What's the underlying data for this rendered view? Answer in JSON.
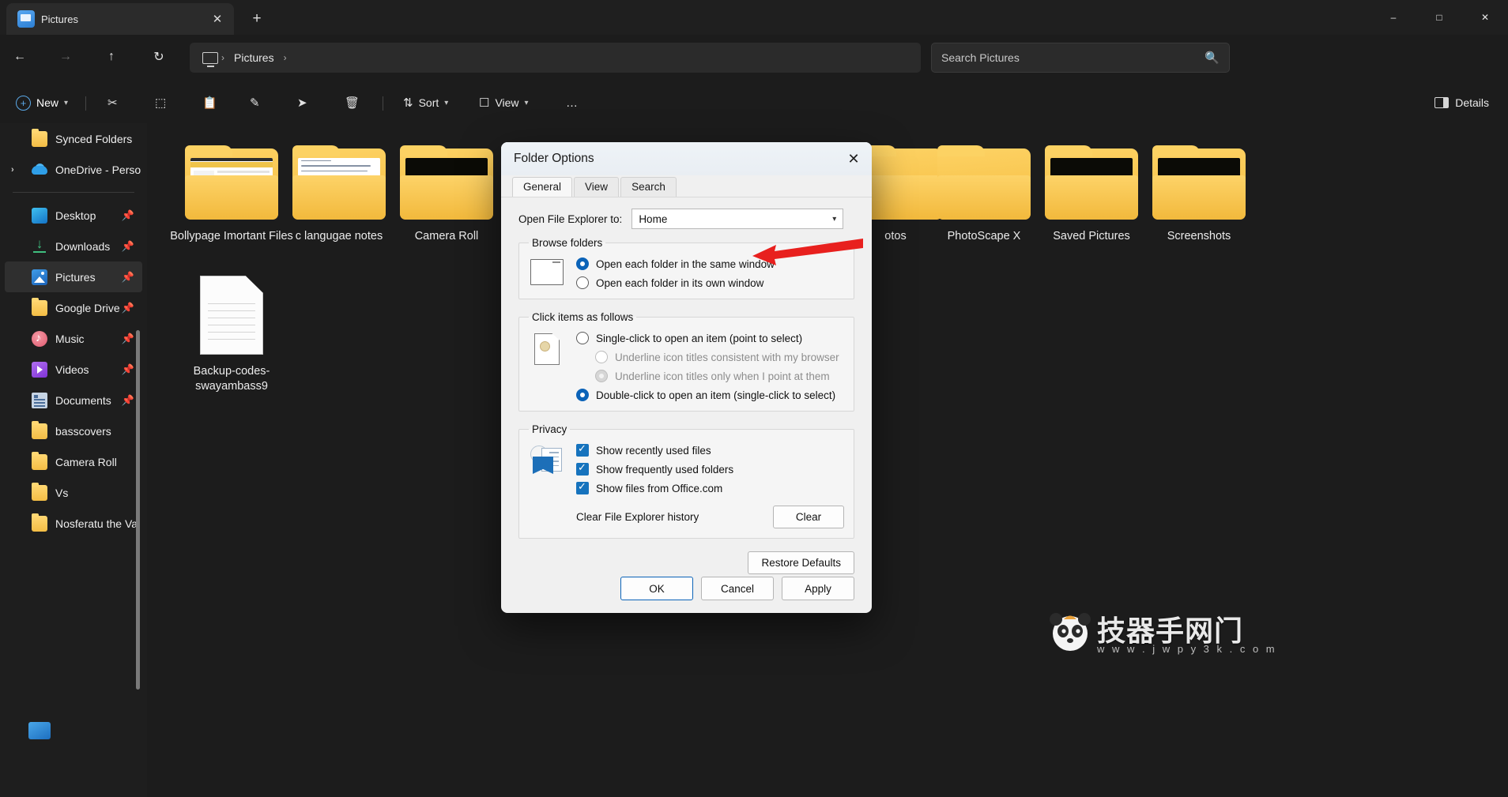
{
  "window": {
    "tab_title": "Pictures",
    "tab_close_icon": "close-icon",
    "new_tab_icon": "plus-icon",
    "minimize_icon": "minimize-icon",
    "maximize_icon": "maximize-icon",
    "close_icon": "close-icon"
  },
  "nav": {
    "back_icon": "arrow-left-icon",
    "forward_icon": "arrow-right-icon",
    "up_icon": "arrow-up-icon",
    "refresh_icon": "refresh-icon",
    "breadcrumb": [
      "Pictures"
    ],
    "separator": "›",
    "pc_icon": "this-pc-icon"
  },
  "search": {
    "placeholder": "Search Pictures",
    "icon": "search-icon"
  },
  "toolbar": {
    "new_label": "New",
    "new_icon": "plus-circle-icon",
    "chevron": "˅",
    "cut_icon": "scissors-icon",
    "copy_icon": "copy-icon",
    "paste_icon": "clipboard-icon",
    "rename_icon": "rename-icon",
    "share_icon": "share-icon",
    "delete_icon": "trash-icon",
    "sort_label": "Sort",
    "sort_icon": "sort-icon",
    "view_label": "View",
    "view_icon": "view-grid-icon",
    "more_label": "…",
    "details_label": "Details",
    "details_icon": "details-pane-icon"
  },
  "sidebar": {
    "items": [
      {
        "label": "Synced Folders",
        "icon": "folder-icon",
        "pinned": false,
        "expandable": false,
        "selected": false
      },
      {
        "label": "OneDrive - Perso",
        "icon": "cloud-icon",
        "pinned": false,
        "expandable": true,
        "selected": false
      },
      {
        "label": "Desktop",
        "icon": "desktop-icon",
        "pinned": true,
        "expandable": false,
        "selected": false
      },
      {
        "label": "Downloads",
        "icon": "download-icon",
        "pinned": true,
        "expandable": false,
        "selected": false
      },
      {
        "label": "Pictures",
        "icon": "pictures-icon",
        "pinned": true,
        "expandable": false,
        "selected": true
      },
      {
        "label": "Google Drive",
        "icon": "folder-icon",
        "pinned": true,
        "expandable": false,
        "selected": false
      },
      {
        "label": "Music",
        "icon": "music-icon",
        "pinned": true,
        "expandable": false,
        "selected": false
      },
      {
        "label": "Videos",
        "icon": "videos-icon",
        "pinned": true,
        "expandable": false,
        "selected": false
      },
      {
        "label": "Documents",
        "icon": "documents-icon",
        "pinned": true,
        "expandable": false,
        "selected": false
      },
      {
        "label": "basscovers",
        "icon": "folder-icon",
        "pinned": false,
        "expandable": false,
        "selected": false
      },
      {
        "label": "Camera Roll",
        "icon": "folder-icon",
        "pinned": false,
        "expandable": false,
        "selected": false
      },
      {
        "label": "Vs",
        "icon": "folder-icon",
        "pinned": false,
        "expandable": false,
        "selected": false
      },
      {
        "label": "Nosferatu the Va",
        "icon": "folder-icon",
        "pinned": false,
        "expandable": false,
        "selected": false
      }
    ],
    "pin_icon": "pin-icon",
    "expander_icon": "chevron-right-icon"
  },
  "files": [
    {
      "name": "Bollypage Imortant Files",
      "type": "folder",
      "preview": "document"
    },
    {
      "name": "c langugae notes",
      "type": "folder",
      "preview": "notes"
    },
    {
      "name": "Camera Roll",
      "type": "folder",
      "preview": "dark"
    },
    {
      "name": "otos",
      "type": "folder",
      "preview": "plain"
    },
    {
      "name": "PhotoScape X",
      "type": "folder",
      "preview": "plain"
    },
    {
      "name": "Saved Pictures",
      "type": "folder",
      "preview": "dark"
    },
    {
      "name": "Screenshots",
      "type": "folder",
      "preview": "dark"
    },
    {
      "name": "Backup-codes-swayambass9",
      "type": "file",
      "preview": "text"
    }
  ],
  "dialog": {
    "title": "Folder Options",
    "close_icon": "close-icon",
    "tabs": [
      {
        "label": "General",
        "active": true
      },
      {
        "label": "View",
        "active": false
      },
      {
        "label": "Search",
        "active": false
      }
    ],
    "open_explorer": {
      "label": "Open File Explorer to:",
      "value": "Home",
      "chevron": "˅"
    },
    "browse_folders": {
      "legend": "Browse folders",
      "icon": "window-icon",
      "options": [
        {
          "label": "Open each folder in the same window",
          "selected": true,
          "disabled": false
        },
        {
          "label": "Open each folder in its own window",
          "selected": false,
          "disabled": false
        }
      ]
    },
    "click_items": {
      "legend": "Click items as follows",
      "icon": "page-cursor-icon",
      "options": [
        {
          "label": "Single-click to open an item (point to select)",
          "selected": false,
          "disabled": false,
          "sub": false
        },
        {
          "label": "Underline icon titles consistent with my browser",
          "selected": false,
          "disabled": true,
          "sub": true
        },
        {
          "label": "Underline icon titles only when I point at them",
          "selected": true,
          "disabled": true,
          "sub": true
        },
        {
          "label": "Double-click to open an item (single-click to select)",
          "selected": true,
          "disabled": false,
          "sub": false
        }
      ]
    },
    "privacy": {
      "legend": "Privacy",
      "icon": "privacy-history-icon",
      "checkboxes": [
        {
          "label": "Show recently used files",
          "checked": true
        },
        {
          "label": "Show frequently used folders",
          "checked": true
        },
        {
          "label": "Show files from Office.com",
          "checked": true
        }
      ],
      "clear_label": "Clear File Explorer history",
      "clear_button": "Clear"
    },
    "restore_defaults": "Restore Defaults",
    "footer": {
      "ok": "OK",
      "cancel": "Cancel",
      "apply": "Apply"
    }
  },
  "annotation": {
    "arrow_color": "#e8201e",
    "arrow_target": "Open each folder in the same window"
  },
  "watermark": {
    "text": "技器手网门",
    "sub": "w w w . j w p y 3 k . c o m",
    "logo_icon": "panda-logo-icon"
  }
}
